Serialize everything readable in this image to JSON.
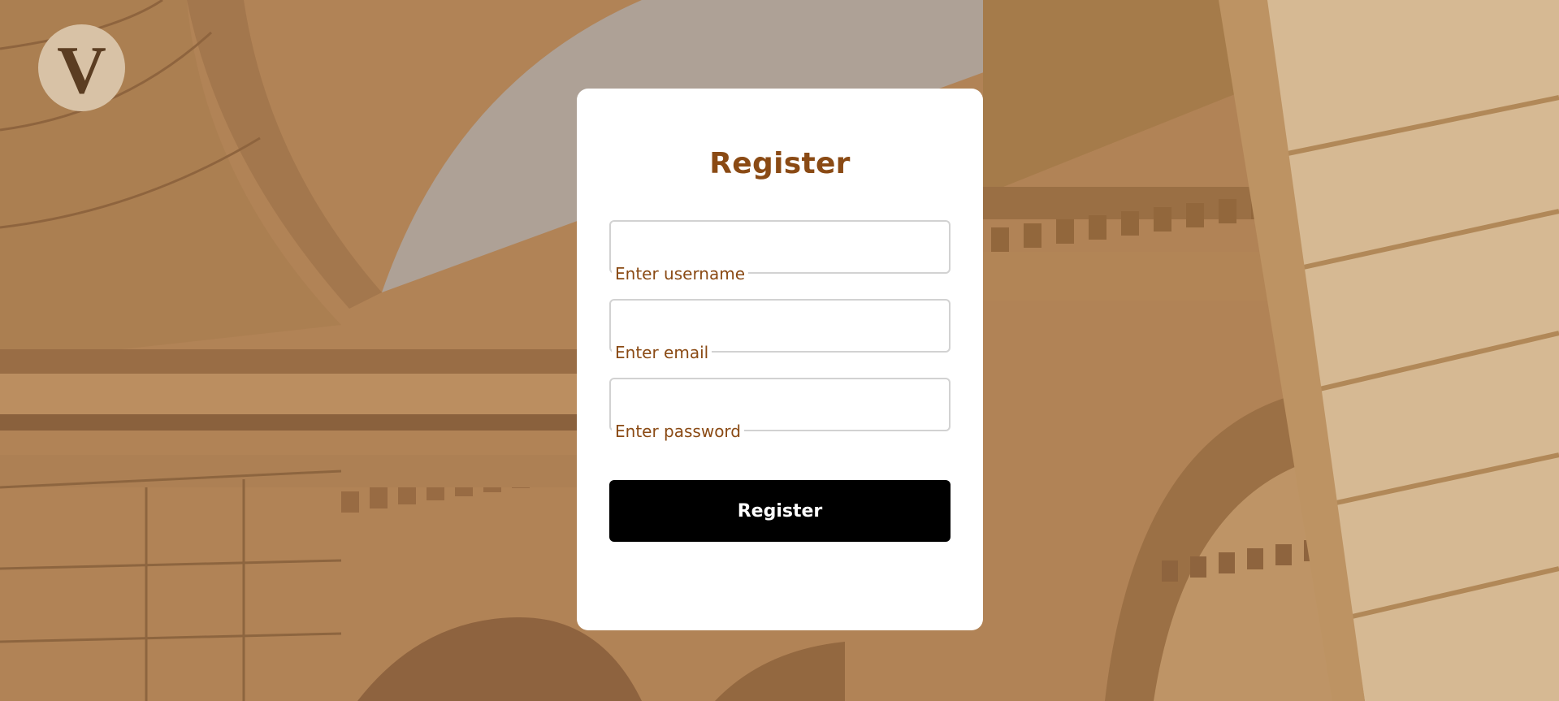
{
  "logo": {
    "letter": "V"
  },
  "form": {
    "title": "Register",
    "fields": [
      {
        "label": "Enter username",
        "value": ""
      },
      {
        "label": "Enter email",
        "value": ""
      },
      {
        "label": "Enter password",
        "value": ""
      }
    ],
    "submit_label": "Register"
  },
  "colors": {
    "accent": "#8a4a14",
    "button": "#000000",
    "card": "#ffffff",
    "logo_circle": "#d8c2a6",
    "logo_letter": "#5b3d22"
  }
}
